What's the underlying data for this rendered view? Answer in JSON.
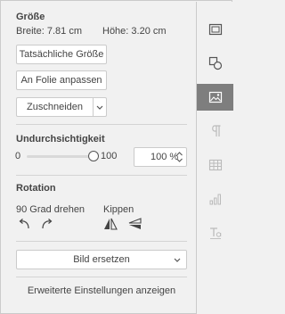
{
  "size": {
    "header": "Größe",
    "width_label": "Breite: 7.81 cm",
    "height_label": "Höhe: 3.20 cm",
    "actual_size_button": "Tatsächliche Größe",
    "fit_slide_button": "An Folie anpassen",
    "crop_button": "Zuschneiden"
  },
  "opacity": {
    "header": "Undurchsichtigkeit",
    "min_label": "0",
    "max_label": "100",
    "level": 1.0,
    "value": "100 %"
  },
  "rotation": {
    "header": "Rotation",
    "rotate_label": "90 Grad drehen",
    "flip_label": "Kippen"
  },
  "replace_image_dropdown": "Bild ersetzen",
  "advanced_settings_link": "Erweiterte Einstellungen anzeigen",
  "sidebar": {
    "items": [
      "slide-settings-icon",
      "shape-settings-icon",
      "image-settings-icon",
      "paragraph-settings-icon",
      "table-settings-icon",
      "chart-settings-icon",
      "textart-settings-icon"
    ],
    "active": "image-settings-icon"
  },
  "colors": {
    "active_tab": "#7e7e7e",
    "panel_bg": "#f1f1f1",
    "border": "#cbcbcb"
  }
}
